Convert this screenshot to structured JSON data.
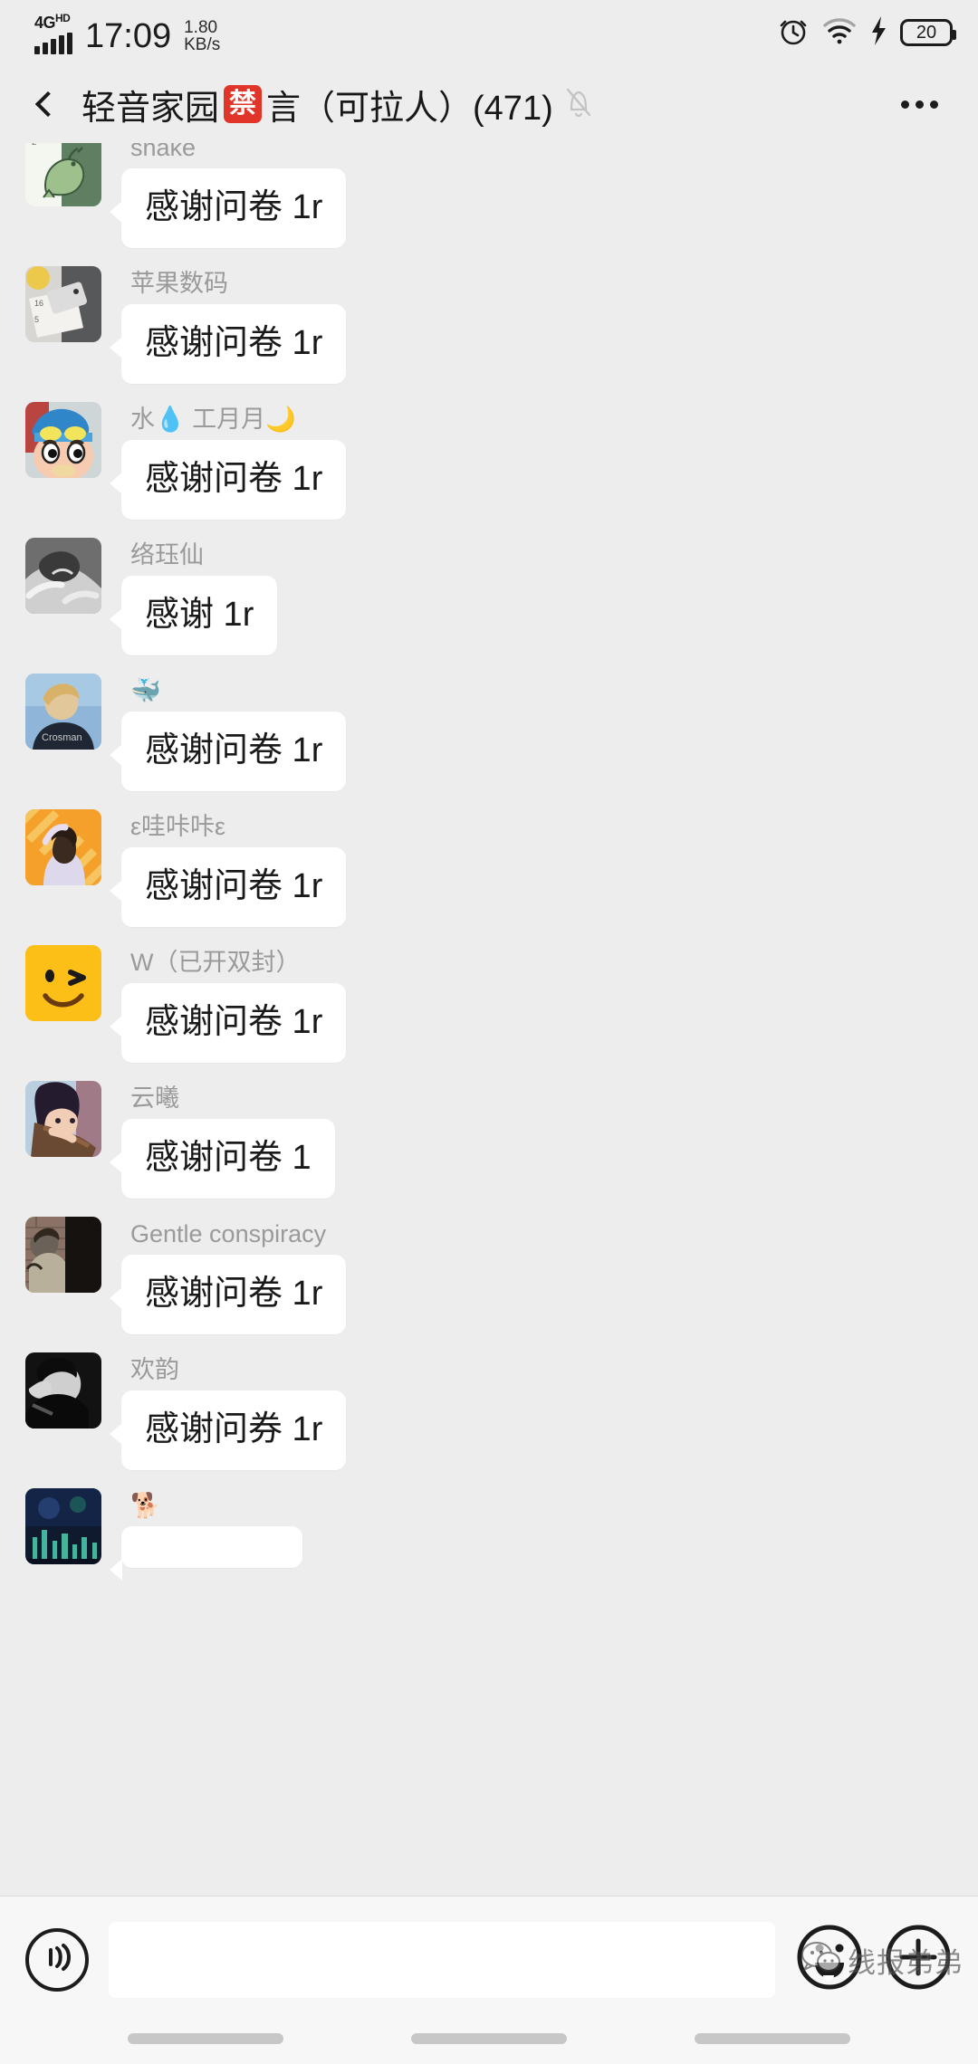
{
  "status_bar": {
    "network_type": "4G",
    "network_type_sup": "HD",
    "time": "17:09",
    "speed_value": "1.80",
    "speed_unit": "KB/s",
    "alarm_icon": "alarm-clock-icon",
    "wifi_icon": "wifi-icon",
    "charging_icon": "lightning-bolt-icon",
    "battery_level": "20"
  },
  "header": {
    "back_icon": "back-chevron-icon",
    "title_part1": "轻音家园",
    "ban_badge": "禁",
    "title_part2": "言（可拉人）(471)",
    "mute_icon": "bell-muted-icon",
    "more_icon": "more-options-icon"
  },
  "messages": [
    {
      "sender": "snake",
      "text": "感谢问卷 1r",
      "avatar": "dinosaur-avatar"
    },
    {
      "sender": "苹果数码",
      "text": "感谢问卷 1r",
      "avatar": "phone-desk-avatar"
    },
    {
      "sender": "水💧 工月月🌙",
      "text": "感谢问卷 1r",
      "avatar": "crayon-shinchan-avatar"
    },
    {
      "sender": "络珏仙",
      "text": "感谢 1r",
      "avatar": "grayscale-anime-avatar"
    },
    {
      "sender": "🐳",
      "text": "感谢问卷 1r",
      "avatar": "blue-portrait-avatar"
    },
    {
      "sender": "ε哇咔咔ε",
      "text": "感谢问卷 1r",
      "avatar": "orange-girl-avatar"
    },
    {
      "sender": "W（已开双封）",
      "text": "感谢问卷 1r",
      "avatar": "yellow-wink-face-avatar"
    },
    {
      "sender": "云曦",
      "text": "感谢问卷 1",
      "avatar": "anime-flute-avatar"
    },
    {
      "sender": "Gentle conspiracy",
      "text": "感谢问卷 1r",
      "avatar": "brick-wall-avatar"
    },
    {
      "sender": "欢韵",
      "text": "感谢问券 1r",
      "avatar": "dark-portrait-avatar"
    },
    {
      "sender": "🐕",
      "text": "",
      "avatar": "night-city-avatar"
    }
  ],
  "input_bar": {
    "voice_icon": "voice-message-icon",
    "input_value": "",
    "input_placeholder": "",
    "emoji_icon": "emoji-smiley-icon",
    "plus_icon": "add-plus-icon"
  },
  "watermark": {
    "logo_icon": "wechat-bubble-icon",
    "text": "线报弟弟"
  },
  "colors": {
    "page_bg": "#ededed",
    "bubble_bg": "#ffffff",
    "ban_red": "#e2352a",
    "sender_gray": "#9a9a9a"
  }
}
